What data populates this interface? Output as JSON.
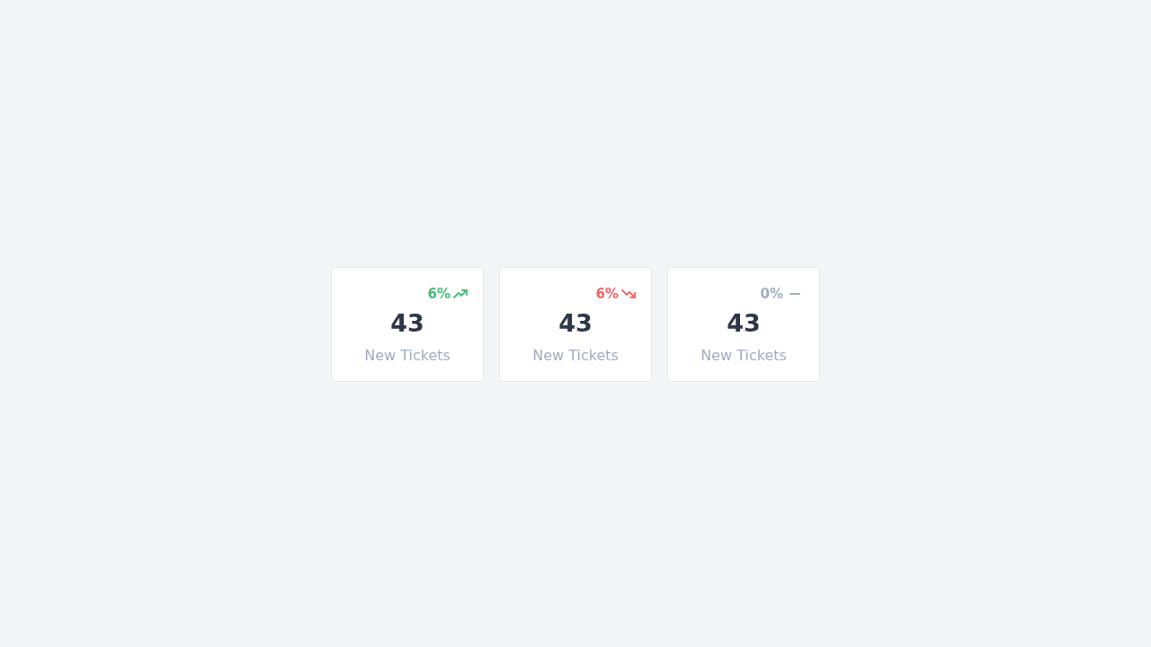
{
  "cards": [
    {
      "kind": "up",
      "change": "6%",
      "value": "43",
      "label": "New Tickets"
    },
    {
      "kind": "down",
      "change": "6%",
      "value": "43",
      "label": "New Tickets"
    },
    {
      "kind": "flat",
      "change": "0%",
      "value": "43",
      "label": "New Tickets"
    }
  ]
}
